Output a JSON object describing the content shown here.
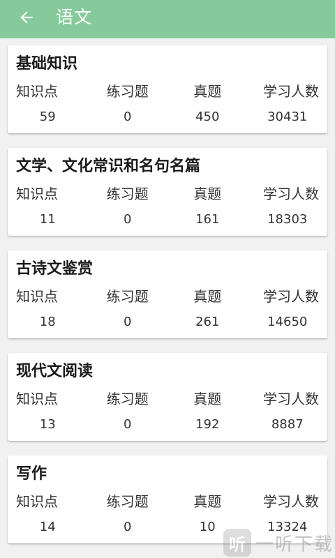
{
  "header": {
    "title": "语文",
    "back_icon": "arrow-left-icon",
    "bg_color": "#86c99a"
  },
  "columns": [
    "知识点",
    "练习题",
    "真题",
    "学习人数"
  ],
  "cards": [
    {
      "title": "基础知识",
      "values": [
        "59",
        "0",
        "450",
        "30431"
      ]
    },
    {
      "title": "文学、文化常识和名句名篇",
      "values": [
        "11",
        "0",
        "161",
        "18303"
      ]
    },
    {
      "title": "古诗文鉴赏",
      "values": [
        "18",
        "0",
        "261",
        "14650"
      ]
    },
    {
      "title": "现代文阅读",
      "values": [
        "13",
        "0",
        "192",
        "8887"
      ]
    },
    {
      "title": "写作",
      "values": [
        "14",
        "0",
        "10",
        "13324"
      ]
    }
  ],
  "watermark": {
    "logo_text": "听",
    "text": "一听下载"
  }
}
